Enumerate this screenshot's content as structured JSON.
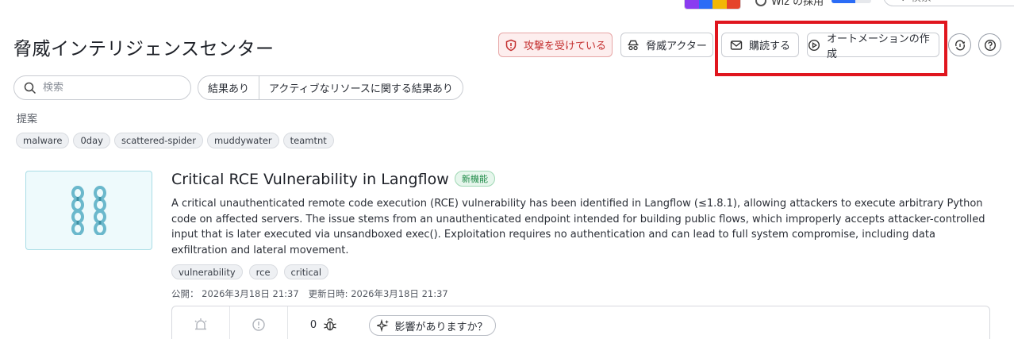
{
  "topbar": {
    "logo_colors": [
      "#8a3cf0",
      "#2b6cf6",
      "#f2b705",
      "#e5442a"
    ],
    "wiz_label": "Wiz の採用",
    "wiz_progress": 0.6,
    "search_placeholder": "検索"
  },
  "header": {
    "title": "脅威インテリジェンスセンター",
    "buttons": {
      "attacked": "攻撃を受けている",
      "actors": "脅威アクター",
      "subscribe": "購読する",
      "automation": "オートメーションの作成"
    }
  },
  "filters": {
    "search_placeholder": "検索",
    "segments": [
      "結果あり",
      "アクティブなリソースに関する結果あり"
    ]
  },
  "suggestions": {
    "label": "提案",
    "tags": [
      "malware",
      "0day",
      "scattered-spider",
      "muddywater",
      "teamtnt"
    ]
  },
  "card": {
    "title": "Critical RCE Vulnerability in Langflow",
    "badge": "新機能",
    "description": "A critical unauthenticated remote code execution (RCE) vulnerability has been identified in Langflow (≤1.8.1), allowing attackers to execute arbitrary Python code on affected servers. The issue stems from an unauthenticated endpoint intended for building public flows, which improperly accepts attacker-controlled input that is later executed via unsandboxed exec(). Exploitation requires no authentication and can lead to full system compromise, including data exfiltration and lateral movement.",
    "tags": [
      "vulnerability",
      "rce",
      "critical"
    ],
    "published": "公開： 2026年3月18日 21:37",
    "updated": "更新日時: 2026年3月18日 21:37",
    "footer": {
      "bug_count": "0",
      "impact_label": "影響がありますか？"
    }
  },
  "colors": {
    "highlight": "#e0161e",
    "attack_red": "#c42f2f",
    "thumb_accent": "#6bb8cc",
    "new_badge": "#1e8a47"
  }
}
